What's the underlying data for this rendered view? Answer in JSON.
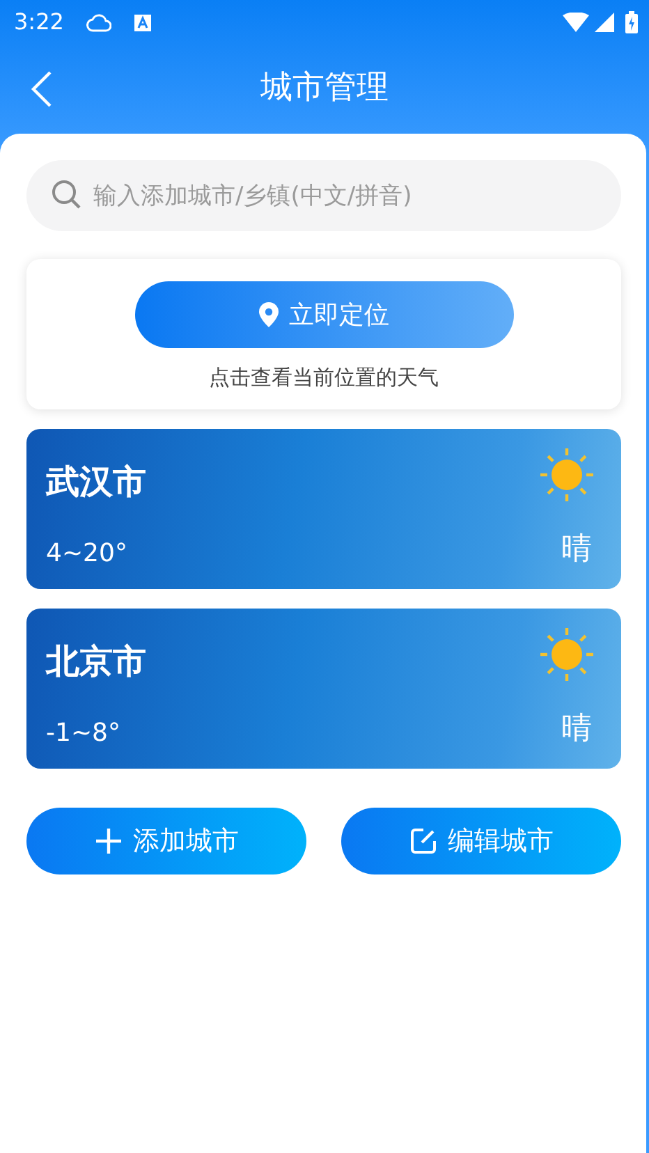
{
  "status_bar": {
    "time": "3:22"
  },
  "header": {
    "title": "城市管理"
  },
  "search": {
    "placeholder": "输入添加城市/乡镇(中文/拼音)"
  },
  "locate": {
    "button": "立即定位",
    "caption": "点击查看当前位置的天气"
  },
  "cities": [
    {
      "name": "武汉市",
      "temp": "4~20°",
      "weather": "晴"
    },
    {
      "name": "北京市",
      "temp": "-1~8°",
      "weather": "晴"
    }
  ],
  "actions": [
    {
      "kind": "add",
      "label": "添加城市"
    },
    {
      "kind": "edit",
      "label": "编辑城市"
    }
  ]
}
